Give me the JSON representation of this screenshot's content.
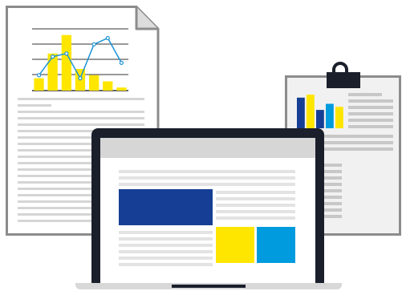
{
  "illustration": {
    "colors": {
      "outline": "#8c8c8c",
      "paper": "#ffffff",
      "clipboard_paper": "#f1f1f1",
      "bar_yellow": "#ffe600",
      "line_blue": "#1b93d6",
      "dark_blue": "#163e94",
      "bright_blue": "#009bde",
      "laptop_frame": "#1a1f2b",
      "laptop_base": "#d8d8d8"
    },
    "document_chart": {
      "bar_values": [
        4,
        12,
        18,
        7,
        5,
        3,
        1
      ],
      "line_values": [
        5,
        11,
        12,
        4,
        15,
        17,
        9
      ],
      "max": 20
    },
    "clipboard_chart": {
      "bars": [
        {
          "value": 10,
          "color": "#163e94"
        },
        {
          "value": 11,
          "color": "#ffe600"
        },
        {
          "value": 6,
          "color": "#163e94"
        },
        {
          "value": 8,
          "color": "#009bde"
        },
        {
          "value": 7,
          "color": "#ffe600"
        }
      ],
      "max": 11
    },
    "icons": {
      "document": "document-icon",
      "clipboard": "clipboard-icon",
      "laptop": "laptop-icon"
    }
  }
}
